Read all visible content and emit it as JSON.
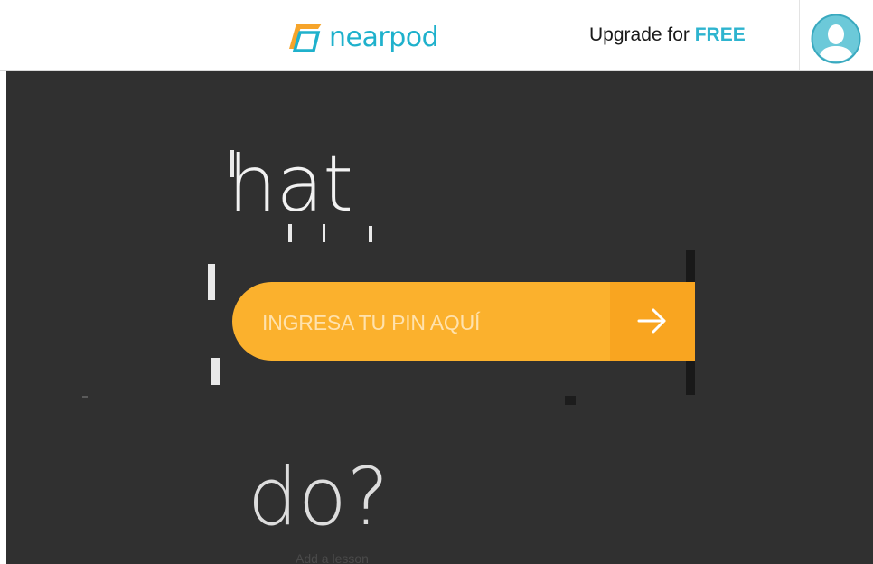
{
  "header": {
    "logo_text": "nearpod",
    "upgrade_prefix": "Upgrade for ",
    "upgrade_highlight": "FREE",
    "accent_color": "#2eb4cf",
    "avatar_icon": "user-avatar-icon"
  },
  "main": {
    "background_text_top": "hat",
    "background_text_bottom": "do?",
    "bottom_faint_text": "Add a lesson",
    "pin_placeholder": "INGRESA TU PIN AQUÍ",
    "submit_icon": "arrow-right-icon",
    "pin_color": "#fbb12d"
  }
}
